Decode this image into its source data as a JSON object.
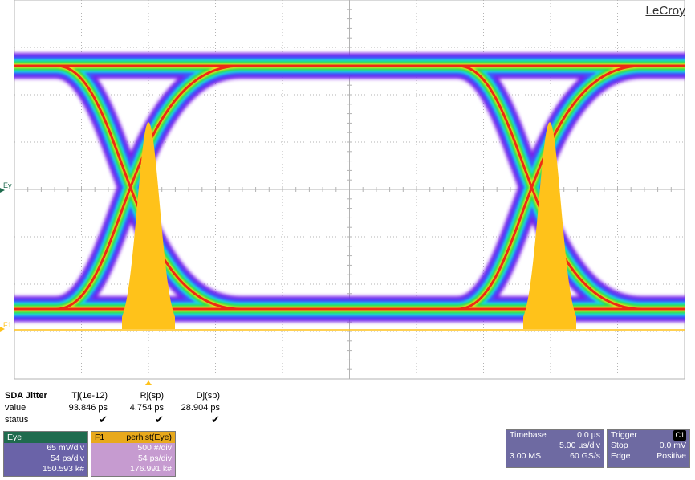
{
  "brand": {
    "logo_text": "LeCroy"
  },
  "trace_labels": {
    "eye": "Ey",
    "f1": "F1"
  },
  "colors": {
    "eye_outer": "#7a1fe8",
    "eye_mid": "#1fd3e0",
    "eye_inner": "#26e048",
    "eye_yellow": "#e8e21e",
    "eye_core": "#ee2a14",
    "histogram": "#ffc21a",
    "grid": "#b3b3b3"
  },
  "measurement": {
    "title": "SDA Jitter",
    "columns": [
      "Tj(1e-12)",
      "Rj(sp)",
      "Dj(sp)"
    ],
    "rows": {
      "value_label": "value",
      "values": [
        "93.846 ps",
        "4.754 ps",
        "28.904 ps"
      ],
      "status_label": "status",
      "status_marks": [
        "✔",
        "✔",
        "✔"
      ]
    }
  },
  "channels": {
    "eye": {
      "name": "Eye",
      "lines": [
        "65 mV/div",
        "54 ps/div",
        "150.593 k#"
      ]
    },
    "f1": {
      "name": "F1",
      "function": "perhist(Eye)",
      "lines": [
        "500 #/div",
        "54 ps/div",
        "176.991 k#"
      ]
    }
  },
  "timebase": {
    "label": "Timebase",
    "delay": "0.0 µs",
    "per_div": "5.00 µs/div",
    "samples": "3.00 MS",
    "rate": "60 GS/s"
  },
  "trigger": {
    "label": "Trigger",
    "channel": "C1",
    "mode": "Stop",
    "level": "0.0 mV",
    "type": "Edge",
    "slope": "Positive"
  }
}
